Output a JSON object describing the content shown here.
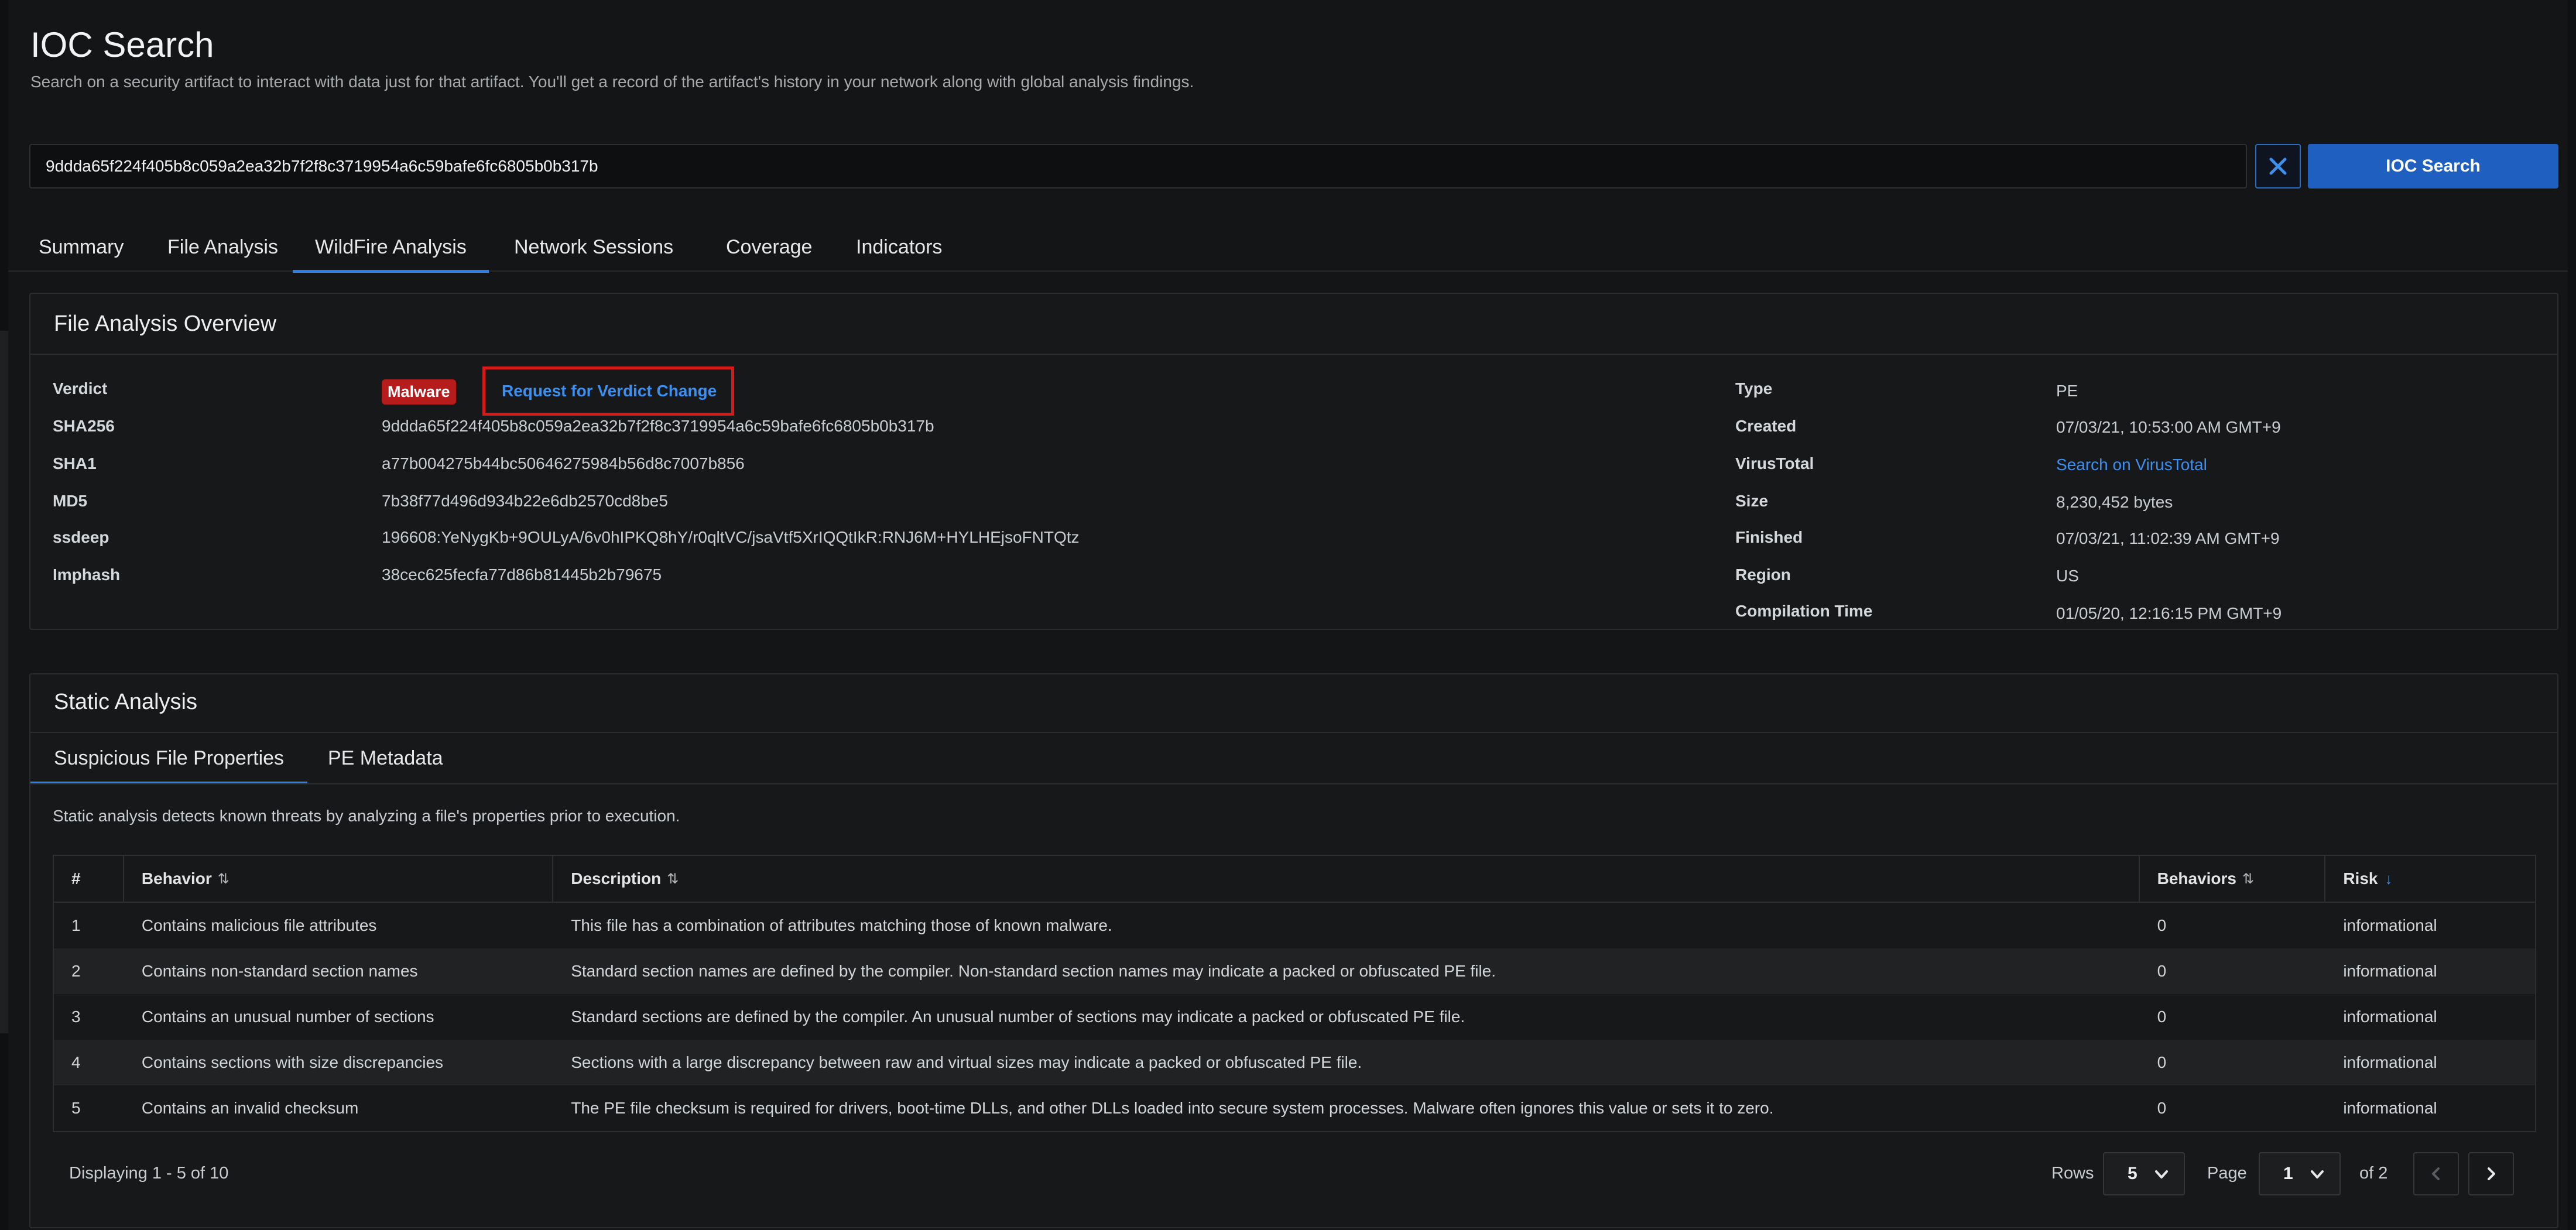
{
  "header": {
    "title": "IOC Search",
    "subtitle": "Search on a security artifact to interact with data just for that artifact. You'll get a record of the artifact's history in your network along with global analysis findings."
  },
  "search": {
    "value": "9ddda65f224f405b8c059a2ea32b7f2f8c3719954a6c59bafe6fc6805b0b317b",
    "button_label": "IOC Search"
  },
  "tabs": [
    {
      "label": "Summary",
      "active": false
    },
    {
      "label": "File Analysis",
      "active": false
    },
    {
      "label": "WildFire Analysis",
      "active": true
    },
    {
      "label": "Network Sessions",
      "active": false
    },
    {
      "label": "Coverage",
      "active": false
    },
    {
      "label": "Indicators",
      "active": false
    }
  ],
  "overview": {
    "title": "File Analysis Overview",
    "verdict_label": "Verdict",
    "verdict_badge": "Malware",
    "verdict_change_link": "Request for Verdict Change",
    "left_fields": [
      {
        "label": "SHA256",
        "value": "9ddda65f224f405b8c059a2ea32b7f2f8c3719954a6c59bafe6fc6805b0b317b"
      },
      {
        "label": "SHA1",
        "value": "a77b004275b44bc50646275984b56d8c7007b856"
      },
      {
        "label": "MD5",
        "value": "7b38f77d496d934b22e6db2570cd8be5"
      },
      {
        "label": "ssdeep",
        "value": "196608:YeNygKb+9OULyA/6v0hIPKQ8hY/r0qltVC/jsaVtf5XrIQQtIkR:RNJ6M+HYLHEjsoFNTQtz"
      },
      {
        "label": "Imphash",
        "value": "38cec625fecfa77d86b81445b2b79675"
      }
    ],
    "right_fields": [
      {
        "label": "Type",
        "value": "PE"
      },
      {
        "label": "Created",
        "value": "07/03/21, 10:53:00 AM GMT+9"
      },
      {
        "label": "VirusTotal",
        "value": "Search on VirusTotal"
      },
      {
        "label": "Size",
        "value": "8,230,452 bytes"
      },
      {
        "label": "Finished",
        "value": "07/03/21, 11:02:39 AM GMT+9"
      },
      {
        "label": "Region",
        "value": "US"
      },
      {
        "label": "Compilation Time",
        "value": "01/05/20, 12:16:15 PM GMT+9"
      }
    ]
  },
  "static": {
    "title": "Static Analysis",
    "subtabs": [
      {
        "label": "Suspicious File Properties",
        "active": true
      },
      {
        "label": "PE Metadata",
        "active": false
      }
    ],
    "description": "Static analysis detects known threats by analyzing a file's properties prior to execution.",
    "columns": [
      "#",
      "Behavior",
      "Description",
      "Behaviors",
      "Risk"
    ],
    "rows": [
      {
        "n": "1",
        "behavior": "Contains malicious file attributes",
        "description": "This file has a combination of attributes matching those of known malware.",
        "behaviors": "0",
        "risk": "informational"
      },
      {
        "n": "2",
        "behavior": "Contains non-standard section names",
        "description": "Standard section names are defined by the compiler. Non-standard section names may indicate a packed or obfuscated PE file.",
        "behaviors": "0",
        "risk": "informational"
      },
      {
        "n": "3",
        "behavior": "Contains an unusual number of sections",
        "description": "Standard sections are defined by the compiler. An unusual number of sections may indicate a packed or obfuscated PE file.",
        "behaviors": "0",
        "risk": "informational"
      },
      {
        "n": "4",
        "behavior": "Contains sections with size discrepancies",
        "description": "Sections with a large discrepancy between raw and virtual sizes may indicate a packed or obfuscated PE file.",
        "behaviors": "0",
        "risk": "informational"
      },
      {
        "n": "5",
        "behavior": "Contains an invalid checksum",
        "description": "The PE file checksum is required for drivers, boot-time DLLs, and other DLLs loaded into secure system processes. Malware often ignores this value or sets it to zero.",
        "behaviors": "0",
        "risk": "informational"
      }
    ],
    "pagination": {
      "displaying": "Displaying 1 - 5 of 10",
      "rows_label": "Rows",
      "rows_value": "5",
      "page_label": "Page",
      "page_value": "1",
      "of_pages": "of 2"
    }
  },
  "icons": {
    "clear": "close-icon",
    "sort": "sort-icon",
    "sort_desc": "arrow-down-icon",
    "chevron": "chevron-down-icon",
    "prev": "chevron-left-icon",
    "next": "chevron-right-icon"
  },
  "colors": {
    "accent": "#2f7ee6",
    "link": "#3d8ff0",
    "malware": "#b71c1c",
    "highlight": "#d61a1a",
    "primary_button": "#1e5fbf"
  }
}
